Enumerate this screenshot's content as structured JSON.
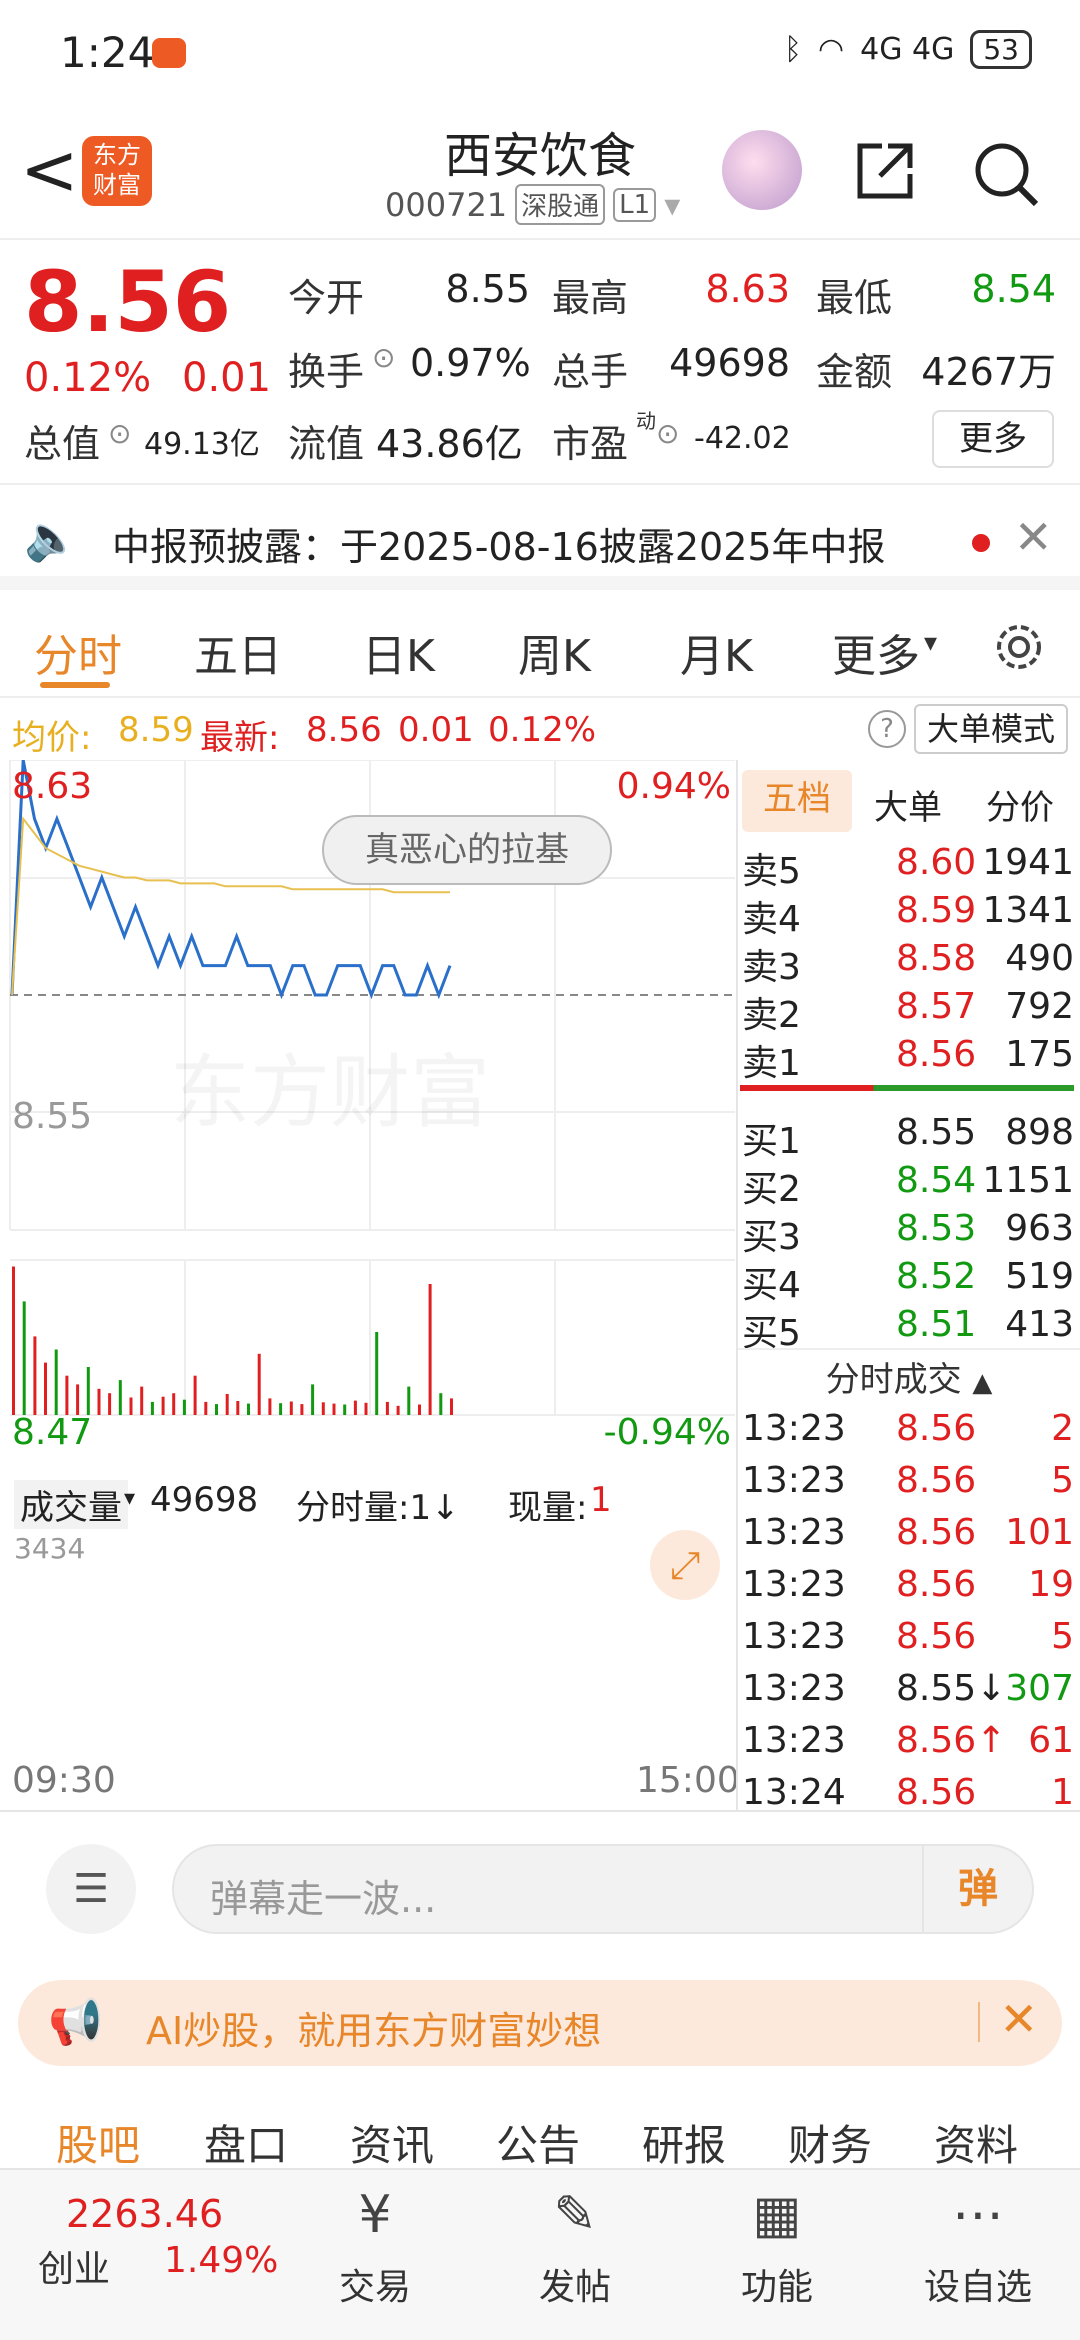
{
  "status_bar": {
    "time": "1:24",
    "network": "4G 4G",
    "battery": "53"
  },
  "header": {
    "back": "<",
    "logo_text": "东方财富",
    "stock_name": "西安饮食",
    "stock_code": "000721",
    "tag1": "深股通",
    "tag2": "L1"
  },
  "quote": {
    "price": "8.56",
    "change_pct": "0.12%",
    "change": "0.01",
    "open_label": "今开",
    "open": "8.55",
    "high_label": "最高",
    "high": "8.63",
    "low_label": "最低",
    "low": "8.54",
    "turnover_label": "换手",
    "turnover": "0.97%",
    "volume_label": "总手",
    "volume": "49698",
    "amount_label": "金额",
    "amount": "4267万",
    "mktcap_label": "总值",
    "mktcap": "49.13亿",
    "float_label": "流值",
    "float": "43.86亿",
    "pe_label": "市盈",
    "pe_sup": "动",
    "pe": "-42.02",
    "more": "更多"
  },
  "notice": {
    "text": "中报预披露：于2025-08-16披露2025年中报"
  },
  "tabs": [
    "分时",
    "五日",
    "日K",
    "周K",
    "月K",
    "更多"
  ],
  "info_line": {
    "avg_label": "均价:",
    "avg": "8.59",
    "latest_label": "最新:",
    "latest": "8.56",
    "change": "0.01",
    "pct": "0.12%",
    "help": "?",
    "big_mode": "大单模式"
  },
  "chart": {
    "y_top": "8.63",
    "y_mid": "8.55",
    "y_bot": "8.47",
    "pct_top": "0.94%",
    "pct_bot": "-0.94%",
    "danmu": "真恶心的拉基",
    "vol_label": "成交量",
    "vol_value": "49698",
    "fen_label": "分时量:1↓",
    "xian_label": "现量:",
    "xian_value": "1",
    "vol_max": "3434",
    "t_start": "09:30",
    "t_end": "15:00",
    "colors": {
      "price": "#2a6fc9",
      "avg": "#e8c050",
      "up": "#e02020",
      "down": "#119911"
    }
  },
  "chart_data": {
    "type": "line",
    "title": "",
    "ylim": [
      8.47,
      8.63
    ],
    "series": [
      {
        "values": [
          8.55,
          8.63,
          8.61,
          8.6,
          8.61,
          8.6,
          8.59,
          8.58,
          8.59,
          8.58,
          8.57,
          8.58,
          8.57,
          8.56,
          8.57,
          8.56,
          8.57,
          8.56,
          8.56,
          8.56,
          8.57,
          8.56,
          8.56,
          8.56,
          8.55,
          8.56,
          8.56,
          8.55,
          8.55,
          8.56,
          8.56,
          8.56,
          8.55,
          8.56,
          8.56,
          8.55,
          8.55,
          8.56,
          8.55,
          8.56
        ]
      },
      {
        "values": [
          8.55,
          8.61,
          8.605,
          8.6,
          8.598,
          8.596,
          8.594,
          8.593,
          8.592,
          8.591,
          8.59,
          8.59,
          8.589,
          8.589,
          8.589,
          8.588,
          8.588,
          8.588,
          8.588,
          8.587,
          8.587,
          8.587,
          8.587,
          8.587,
          8.587,
          8.586,
          8.586,
          8.586,
          8.586,
          8.586,
          8.586,
          8.586,
          8.586,
          8.586,
          8.585,
          8.585,
          8.585,
          8.585,
          8.585,
          8.585
        ]
      }
    ],
    "volume_max": 3434
  },
  "book": {
    "tabs": [
      "五档",
      "大单",
      "分价"
    ],
    "sell": [
      {
        "label": "卖5",
        "price": "8.60",
        "qty": "1941"
      },
      {
        "label": "卖4",
        "price": "8.59",
        "qty": "1341"
      },
      {
        "label": "卖3",
        "price": "8.58",
        "qty": "490"
      },
      {
        "label": "卖2",
        "price": "8.57",
        "qty": "792"
      },
      {
        "label": "卖1",
        "price": "8.56",
        "qty": "175"
      }
    ],
    "buy": [
      {
        "label": "买1",
        "price": "8.55",
        "qty": "898"
      },
      {
        "label": "买2",
        "price": "8.54",
        "qty": "1151"
      },
      {
        "label": "买3",
        "price": "8.53",
        "qty": "963"
      },
      {
        "label": "买4",
        "price": "8.52",
        "qty": "519"
      },
      {
        "label": "买5",
        "price": "8.51",
        "qty": "413"
      }
    ],
    "ticks_title": "分时成交",
    "ticks": [
      {
        "time": "13:23",
        "price": "8.56",
        "qty": "2"
      },
      {
        "time": "13:23",
        "price": "8.56",
        "qty": "5"
      },
      {
        "time": "13:23",
        "price": "8.56",
        "qty": "101"
      },
      {
        "time": "13:23",
        "price": "8.56",
        "qty": "19"
      },
      {
        "time": "13:23",
        "price": "8.56",
        "qty": "5"
      },
      {
        "time": "13:23",
        "price": "8.55↓",
        "qty": "307"
      },
      {
        "time": "13:23",
        "price": "8.56↑",
        "qty": "61"
      },
      {
        "time": "13:24",
        "price": "8.56",
        "qty": "1"
      }
    ]
  },
  "input": {
    "placeholder": "弹幕走一波...",
    "dan": "弹"
  },
  "ai_banner": {
    "text": "AI炒股，就用东方财富妙想"
  },
  "bottom_tabs": [
    "股吧",
    "盘口",
    "资讯",
    "公告",
    "研报",
    "财务",
    "资料"
  ],
  "nav": {
    "index_value": "2263.46",
    "index_label": "创业",
    "index_pct": "1.49%",
    "items": [
      "交易",
      "发帖",
      "功能",
      "设自选"
    ]
  }
}
